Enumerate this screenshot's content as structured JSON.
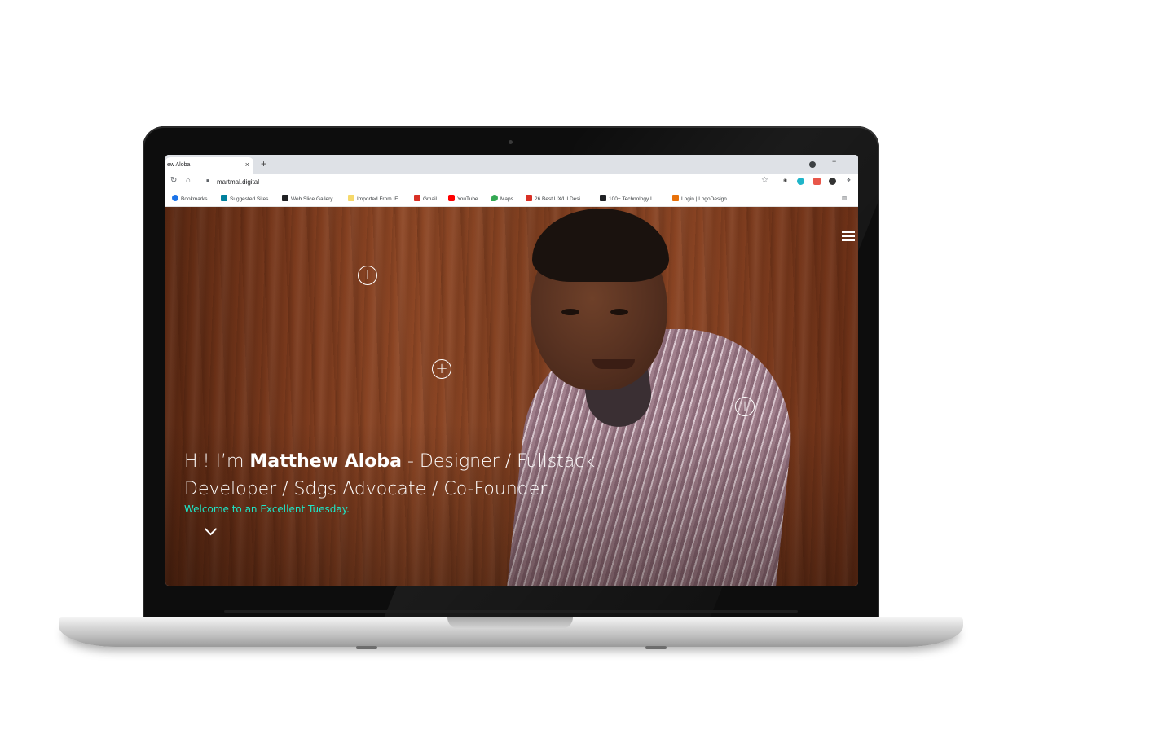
{
  "browser": {
    "tab_title": "ew Aloba",
    "tab_close": "×",
    "new_tab": "+",
    "window_minimize": "−",
    "url": "martmal.digital",
    "bookmarks": [
      {
        "label": "Bookmarks",
        "icon": "star-icon",
        "color": "#1a73e8"
      },
      {
        "label": "Suggested Sites",
        "icon": "bing-icon",
        "color": "#00809d"
      },
      {
        "label": "Web Slice Gallery",
        "icon": "web-slice-icon",
        "color": "#202124"
      },
      {
        "label": "Imported From IE",
        "icon": "folder-icon",
        "color": "#f6d96b"
      },
      {
        "label": "Gmail",
        "icon": "gmail-icon",
        "color": "#d93025"
      },
      {
        "label": "YouTube",
        "icon": "youtube-icon",
        "color": "#ff0000"
      },
      {
        "label": "Maps",
        "icon": "maps-icon",
        "color": "#34a853"
      },
      {
        "label": "26 Best UX/UI Desi...",
        "icon": "mail-icon",
        "color": "#d93025"
      },
      {
        "label": "100+ Technology I...",
        "icon": "tech-icon",
        "color": "#202124"
      },
      {
        "label": "Login | LogoDesign",
        "icon": "logodesign-icon",
        "color": "#e8710a"
      }
    ]
  },
  "hero": {
    "intro_prefix": "Hi! I’m ",
    "intro_name": "Matthew Aloba",
    "intro_roles_line1": " - Designer / Fullstack",
    "intro_roles_line2": "Developer / Sdgs Advocate / Co-Founder",
    "welcome": "Welcome to an Excellent Tuesday.",
    "welcome_color": "#1ee6c8",
    "hotspot_symbol": "+"
  }
}
